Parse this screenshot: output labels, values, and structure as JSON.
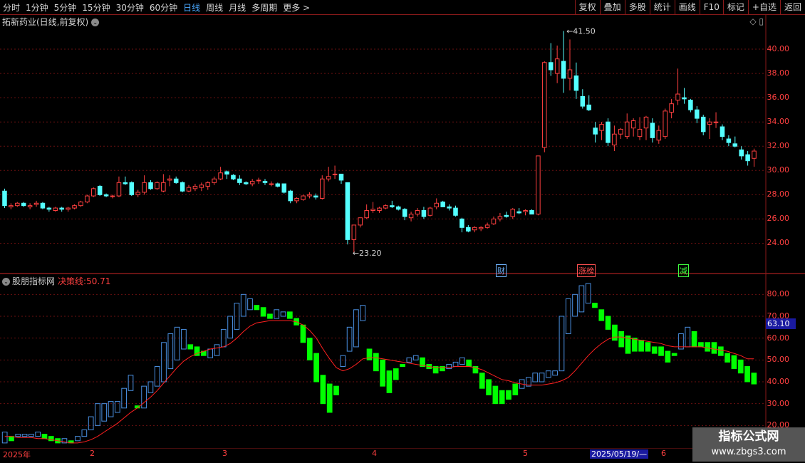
{
  "toolbar": {
    "timeframes": [
      "分时",
      "1分钟",
      "5分钟",
      "15分钟",
      "30分钟",
      "60分钟",
      "日线",
      "周线",
      "月线",
      "多周期",
      "更多 >"
    ],
    "active_index": 6,
    "right_buttons": [
      "复权",
      "叠加",
      "多股",
      "统计",
      "画线",
      "F10",
      "标记",
      "+自选",
      "返回"
    ]
  },
  "panel1": {
    "title": "拓新药业(日线,前复权)",
    "price_labels": [
      "40.00",
      "38.00",
      "36.00",
      "34.00",
      "32.00",
      "30.00",
      "28.00",
      "26.00",
      "24.00"
    ],
    "high_label": "41.50",
    "low_label": "23.20",
    "events": [
      {
        "text": "财",
        "color": "#6fb4ff"
      },
      {
        "text": "涨榜",
        "color": "#ff5050"
      },
      {
        "text": "减",
        "color": "#40ff40"
      }
    ]
  },
  "panel2": {
    "title": "股朋指标网",
    "indicator_label": "决策线:",
    "indicator_value": "50.71",
    "axis_labels": [
      "80.00",
      "70.00",
      "60.00",
      "50.00",
      "40.00",
      "30.00",
      "20.00"
    ],
    "current_value": "63.10"
  },
  "footer": {
    "months": [
      "2025年",
      "2",
      "3",
      "4",
      "5",
      "6"
    ],
    "highlight_date": "2025/05/19/—"
  },
  "watermark": {
    "line1": "指标公式网",
    "line2": "www.zbgs3.com"
  },
  "colors": {
    "up": "#ff4040",
    "down": "#54ffff",
    "ind_up": "#4a90e2",
    "ind_down": "#00ff00",
    "line": "#ff2020"
  },
  "chart_data": [
    {
      "type": "candlestick",
      "title": "拓新药业(日线,前复权)",
      "ylim": [
        22.5,
        42
      ],
      "ohlc": [
        [
          28.3,
          28.5,
          26.9,
          27.1
        ],
        [
          27.0,
          27.3,
          26.8,
          27.1
        ],
        [
          27.1,
          27.4,
          27.0,
          27.3
        ],
        [
          27.3,
          27.4,
          27.0,
          27.1
        ],
        [
          27.0,
          27.3,
          26.8,
          27.1
        ],
        [
          27.2,
          27.5,
          27.0,
          27.3
        ],
        [
          27.3,
          27.4,
          26.8,
          26.9
        ],
        [
          26.9,
          27.0,
          26.6,
          26.8
        ],
        [
          26.7,
          27.0,
          26.6,
          26.9
        ],
        [
          26.9,
          27.0,
          26.6,
          26.8
        ],
        [
          26.8,
          27.0,
          26.6,
          26.9
        ],
        [
          26.9,
          27.2,
          26.8,
          27.1
        ],
        [
          27.1,
          27.5,
          27.0,
          27.4
        ],
        [
          27.4,
          28.0,
          27.3,
          27.9
        ],
        [
          27.9,
          28.6,
          27.8,
          28.5
        ],
        [
          28.7,
          28.8,
          27.9,
          28.0
        ],
        [
          28.0,
          28.1,
          27.8,
          27.9
        ],
        [
          27.9,
          28.0,
          27.7,
          27.9
        ],
        [
          27.9,
          29.5,
          27.8,
          29.0
        ],
        [
          29.0,
          29.5,
          28.8,
          28.9
        ],
        [
          29.0,
          29.1,
          27.9,
          28.0
        ],
        [
          28.0,
          28.4,
          27.8,
          28.2
        ],
        [
          28.2,
          29.6,
          28.0,
          29.0
        ],
        [
          29.0,
          29.2,
          28.4,
          28.5
        ],
        [
          28.5,
          29.1,
          28.4,
          29.0
        ],
        [
          28.3,
          29.7,
          28.2,
          29.0
        ],
        [
          29.2,
          29.6,
          28.7,
          29.3
        ],
        [
          29.3,
          29.5,
          28.9,
          29.0
        ],
        [
          29.0,
          29.1,
          28.2,
          28.3
        ],
        [
          28.3,
          28.8,
          28.2,
          28.6
        ],
        [
          28.5,
          28.9,
          28.3,
          28.7
        ],
        [
          28.6,
          29.0,
          28.3,
          28.8
        ],
        [
          28.7,
          29.1,
          28.4,
          29.0
        ],
        [
          29.0,
          29.5,
          28.8,
          29.3
        ],
        [
          29.3,
          30.3,
          29.2,
          29.8
        ],
        [
          29.9,
          30.0,
          29.3,
          29.7
        ],
        [
          29.6,
          29.7,
          29.2,
          29.3
        ],
        [
          29.3,
          29.6,
          28.8,
          29.0
        ],
        [
          29.0,
          29.1,
          28.8,
          28.9
        ],
        [
          28.9,
          29.3,
          28.7,
          29.1
        ],
        [
          29.2,
          29.4,
          28.9,
          29.2
        ],
        [
          29.1,
          29.3,
          28.8,
          29.0
        ],
        [
          28.9,
          29.1,
          28.7,
          28.9
        ],
        [
          28.9,
          29.0,
          28.6,
          28.7
        ],
        [
          28.9,
          28.9,
          28.1,
          28.2
        ],
        [
          28.3,
          28.4,
          27.3,
          27.5
        ],
        [
          27.5,
          27.8,
          27.3,
          27.7
        ],
        [
          27.6,
          28.0,
          27.5,
          27.9
        ],
        [
          27.9,
          28.2,
          27.7,
          28.0
        ],
        [
          27.9,
          28.1,
          27.6,
          27.8
        ],
        [
          27.7,
          29.6,
          27.6,
          29.3
        ],
        [
          29.3,
          30.3,
          29.1,
          29.5
        ],
        [
          29.7,
          30.4,
          29.3,
          29.7
        ],
        [
          29.7,
          29.7,
          28.9,
          29.2
        ],
        [
          29.0,
          29.0,
          23.9,
          24.3
        ],
        [
          24.3,
          24.8,
          23.2,
          25.5
        ],
        [
          25.5,
          25.7,
          25.3,
          26.1
        ],
        [
          26.1,
          27.2,
          26.0,
          26.7
        ],
        [
          26.7,
          27.4,
          26.5,
          26.8
        ],
        [
          26.7,
          27.0,
          26.5,
          26.9
        ],
        [
          26.9,
          27.2,
          26.8,
          27.1
        ],
        [
          27.1,
          27.5,
          26.9,
          27.0
        ],
        [
          27.0,
          27.1,
          26.7,
          26.8
        ],
        [
          26.8,
          26.9,
          25.9,
          26.2
        ],
        [
          26.1,
          26.6,
          25.8,
          26.4
        ],
        [
          26.4,
          26.9,
          26.2,
          26.7
        ],
        [
          26.7,
          27.0,
          26.0,
          26.2
        ],
        [
          26.3,
          27.0,
          26.2,
          26.9
        ],
        [
          27.0,
          27.7,
          26.8,
          27.3
        ],
        [
          27.4,
          27.5,
          27.0,
          27.0
        ],
        [
          27.0,
          27.2,
          26.7,
          26.9
        ],
        [
          26.9,
          27.1,
          26.2,
          26.3
        ],
        [
          26.0,
          26.1,
          24.9,
          25.3
        ],
        [
          25.3,
          25.5,
          24.9,
          25.0
        ],
        [
          25.1,
          25.4,
          24.9,
          25.3
        ],
        [
          25.2,
          25.4,
          25.0,
          25.3
        ],
        [
          25.3,
          25.7,
          25.2,
          25.5
        ],
        [
          25.6,
          26.2,
          25.5,
          26.0
        ],
        [
          26.0,
          26.5,
          25.8,
          26.2
        ],
        [
          26.3,
          26.6,
          26.1,
          26.2
        ],
        [
          26.2,
          26.9,
          26.0,
          26.8
        ],
        [
          26.6,
          26.9,
          26.4,
          26.5
        ],
        [
          26.6,
          26.8,
          26.3,
          26.7
        ],
        [
          26.7,
          26.8,
          26.4,
          26.4
        ],
        [
          26.4,
          31.2,
          26.3,
          31.2
        ],
        [
          31.9,
          39.0,
          31.5,
          38.9
        ],
        [
          38.9,
          40.5,
          37.8,
          38.3
        ],
        [
          38.0,
          40.3,
          37.2,
          39.2
        ],
        [
          39.0,
          41.5,
          36.4,
          37.6
        ],
        [
          37.6,
          40.8,
          36.6,
          38.3
        ],
        [
          37.8,
          38.9,
          35.9,
          36.6
        ],
        [
          36.1,
          36.7,
          35.1,
          35.3
        ],
        [
          35.4,
          36.2,
          34.9,
          35.0
        ],
        [
          33.5,
          34.0,
          32.3,
          33.0
        ],
        [
          33.3,
          34.0,
          32.5,
          33.8
        ],
        [
          34.0,
          34.3,
          32.0,
          32.3
        ],
        [
          32.1,
          33.7,
          31.6,
          33.0
        ],
        [
          33.0,
          33.5,
          32.6,
          33.4
        ],
        [
          32.8,
          34.7,
          32.6,
          34.0
        ],
        [
          33.5,
          34.3,
          32.8,
          34.1
        ],
        [
          32.8,
          34.4,
          32.5,
          33.4
        ],
        [
          33.5,
          34.5,
          32.5,
          34.4
        ],
        [
          33.9,
          34.3,
          32.3,
          32.7
        ],
        [
          32.5,
          33.7,
          32.2,
          33.3
        ],
        [
          32.8,
          35.1,
          32.6,
          34.9
        ],
        [
          34.8,
          35.9,
          34.3,
          35.5
        ],
        [
          35.8,
          38.4,
          35.4,
          36.3
        ],
        [
          36.0,
          36.8,
          35.5,
          35.9
        ],
        [
          35.8,
          35.9,
          34.8,
          35.0
        ],
        [
          35.0,
          35.3,
          33.9,
          34.3
        ],
        [
          34.4,
          34.6,
          32.9,
          33.2
        ],
        [
          33.8,
          34.3,
          32.6,
          34.0
        ],
        [
          34.0,
          34.8,
          33.5,
          34.0
        ],
        [
          33.6,
          33.8,
          32.5,
          32.8
        ],
        [
          32.6,
          32.9,
          32.0,
          32.3
        ],
        [
          32.2,
          32.8,
          31.9,
          32.0
        ],
        [
          31.7,
          32.0,
          30.9,
          31.2
        ],
        [
          31.3,
          31.6,
          30.4,
          30.8
        ],
        [
          31.0,
          31.8,
          30.3,
          31.6
        ]
      ]
    },
    {
      "type": "bar-indicator",
      "title": "股朋指标网",
      "ylim": [
        10,
        85
      ],
      "bars": [
        [
          12,
          17
        ],
        [
          13,
          15
        ],
        [
          15,
          16
        ],
        [
          15,
          16
        ],
        [
          15,
          16
        ],
        [
          15,
          17
        ],
        [
          14,
          16
        ],
        [
          13,
          15
        ],
        [
          12,
          14
        ],
        [
          12,
          14
        ],
        [
          12,
          13
        ],
        [
          13,
          15
        ],
        [
          15,
          18
        ],
        [
          18,
          24
        ],
        [
          20,
          30
        ],
        [
          22,
          30
        ],
        [
          24,
          31
        ],
        [
          26,
          31
        ],
        [
          28,
          37
        ],
        [
          36,
          43
        ],
        [
          28,
          29
        ],
        [
          28,
          38
        ],
        [
          35,
          40
        ],
        [
          38,
          47
        ],
        [
          40,
          58
        ],
        [
          46,
          62
        ],
        [
          50,
          65
        ],
        [
          55,
          64
        ],
        [
          55,
          57
        ],
        [
          52,
          56
        ],
        [
          52,
          54
        ],
        [
          51,
          55
        ],
        [
          52,
          57
        ],
        [
          56,
          64
        ],
        [
          60,
          70
        ],
        [
          64,
          76
        ],
        [
          70,
          80
        ],
        [
          73,
          78
        ],
        [
          73,
          75
        ],
        [
          70,
          74
        ],
        [
          69,
          71
        ],
        [
          69,
          73
        ],
        [
          70,
          72
        ],
        [
          69,
          72
        ],
        [
          66,
          69
        ],
        [
          58,
          66
        ],
        [
          50,
          60
        ],
        [
          40,
          53
        ],
        [
          30,
          43
        ],
        [
          26,
          39
        ],
        [
          34,
          38
        ],
        [
          47,
          52
        ],
        [
          54,
          65
        ],
        [
          56,
          73
        ],
        [
          68,
          75
        ],
        [
          50,
          55
        ],
        [
          45,
          53
        ],
        [
          38,
          50
        ],
        [
          35,
          45
        ],
        [
          41,
          46
        ],
        [
          47,
          48
        ],
        [
          49,
          51
        ],
        [
          50,
          52
        ],
        [
          47,
          51
        ],
        [
          46,
          48
        ],
        [
          44,
          47
        ],
        [
          45,
          47
        ],
        [
          46,
          48
        ],
        [
          47,
          49
        ],
        [
          48,
          51
        ],
        [
          47,
          50
        ],
        [
          44,
          47
        ],
        [
          37,
          44
        ],
        [
          34,
          41
        ],
        [
          30,
          38
        ],
        [
          30,
          36
        ],
        [
          32,
          36
        ],
        [
          34,
          39
        ],
        [
          37,
          41
        ],
        [
          38,
          42
        ],
        [
          40,
          44
        ],
        [
          40,
          44
        ],
        [
          42,
          45
        ],
        [
          43,
          45
        ],
        [
          45,
          70
        ],
        [
          62,
          78
        ],
        [
          70,
          80
        ],
        [
          72,
          84
        ],
        [
          76,
          85
        ],
        [
          74,
          76
        ],
        [
          68,
          73
        ],
        [
          64,
          70
        ],
        [
          59,
          66
        ],
        [
          56,
          63
        ],
        [
          53,
          61
        ],
        [
          54,
          60
        ],
        [
          54,
          59
        ],
        [
          54,
          58
        ],
        [
          53,
          56
        ],
        [
          52,
          56
        ],
        [
          49,
          54
        ],
        [
          52,
          53
        ],
        [
          55,
          62
        ],
        [
          56,
          65
        ],
        [
          56,
          63
        ],
        [
          56,
          58
        ],
        [
          54,
          58
        ],
        [
          53,
          58
        ],
        [
          52,
          56
        ],
        [
          49,
          53
        ],
        [
          46,
          52
        ],
        [
          44,
          50
        ],
        [
          40,
          47
        ],
        [
          39,
          44
        ]
      ],
      "line": [
        15,
        15,
        14.5,
        14.5,
        14.5,
        14,
        14,
        13.5,
        13,
        12.5,
        12,
        12,
        12.5,
        13.5,
        15,
        17,
        19,
        21,
        23.5,
        26,
        28,
        30.5,
        33,
        36,
        39.5,
        43,
        46.5,
        49.5,
        51.5,
        53,
        54,
        55,
        55.5,
        56,
        57.5,
        60,
        63,
        65.5,
        67,
        67.5,
        68,
        68,
        68,
        68,
        67.5,
        66,
        63.5,
        60,
        55,
        50.5,
        46.5,
        45,
        46,
        48,
        50.5,
        51,
        51,
        50.5,
        50,
        49.5,
        49,
        48.5,
        48,
        47.5,
        47,
        46.5,
        46.5,
        46.5,
        47,
        47,
        47,
        46.5,
        45.5,
        44,
        42.5,
        41,
        40.5,
        39.5,
        39,
        38.5,
        38.5,
        38.5,
        39,
        39.5,
        40.5,
        42,
        45,
        48.5,
        52,
        55,
        57.5,
        59.5,
        60.5,
        60.5,
        60,
        59.5,
        59,
        58.5,
        58,
        57.5,
        56.5,
        56,
        56,
        56,
        56,
        56,
        55.5,
        55,
        54.5,
        54,
        53,
        52,
        50.5,
        50.5
      ]
    }
  ]
}
